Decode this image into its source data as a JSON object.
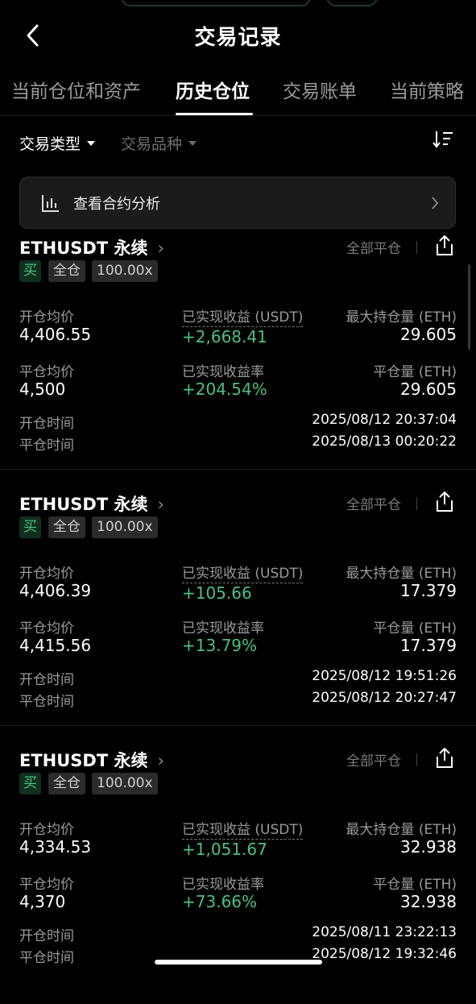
{
  "header": {
    "title": "交易记录"
  },
  "tabs": [
    {
      "label": "当前仓位和资产"
    },
    {
      "label": "历史仓位"
    },
    {
      "label": "交易账单"
    },
    {
      "label": "当前策略"
    }
  ],
  "filters": {
    "trade_type": "交易类型",
    "instrument": "交易品种"
  },
  "analysis": {
    "label": "查看合约分析"
  },
  "labels": {
    "close_all": "全部平仓",
    "open_avg": "开仓均价",
    "close_avg": "平仓均价",
    "realized_pnl": "已实现收益 (USDT)",
    "realized_pnl_rate": "已实现收益率",
    "max_position": "最大持仓量 (ETH)",
    "close_qty": "平仓量 (ETH)",
    "open_time": "开仓时间",
    "close_time": "平仓时间"
  },
  "positions": [
    {
      "symbol": "ETHUSDT 永续",
      "side": "买",
      "margin_mode": "全仓",
      "leverage": "100.00x",
      "open_avg": "4,406.55",
      "close_avg": "4,500",
      "realized_pnl": "+2,668.41",
      "realized_pnl_rate": "+204.54%",
      "max_position": "29.605",
      "close_qty": "29.605",
      "open_time": "2025/08/12 20:37:04",
      "close_time": "2025/08/13 00:20:22"
    },
    {
      "symbol": "ETHUSDT 永续",
      "side": "买",
      "margin_mode": "全仓",
      "leverage": "100.00x",
      "open_avg": "4,406.39",
      "close_avg": "4,415.56",
      "realized_pnl": "+105.66",
      "realized_pnl_rate": "+13.79%",
      "max_position": "17.379",
      "close_qty": "17.379",
      "open_time": "2025/08/12 19:51:26",
      "close_time": "2025/08/12 20:27:47"
    },
    {
      "symbol": "ETHUSDT 永续",
      "side": "买",
      "margin_mode": "全仓",
      "leverage": "100.00x",
      "open_avg": "4,334.53",
      "close_avg": "4,370",
      "realized_pnl": "+1,051.67",
      "realized_pnl_rate": "+73.66%",
      "max_position": "32.938",
      "close_qty": "32.938",
      "open_time": "2025/08/11 23:22:13",
      "close_time": "2025/08/12 19:32:46"
    }
  ],
  "colors": {
    "positive": "#4cc17e",
    "background": "#000000"
  }
}
